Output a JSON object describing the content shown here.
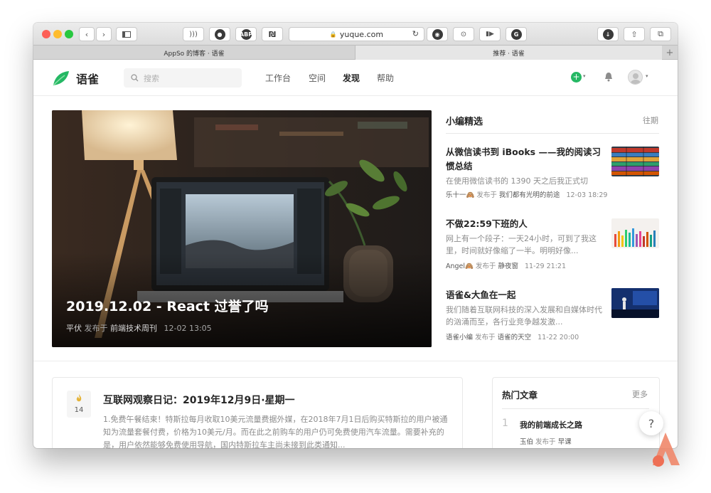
{
  "browser": {
    "url": "yuque.com",
    "tabs": [
      {
        "label": "AppSo 的博客 · 语雀",
        "active": false
      },
      {
        "label": "推荐 · 语雀",
        "active": true
      }
    ],
    "new_tab_symbol": "+"
  },
  "site": {
    "logo_text": "语雀",
    "search_placeholder": "搜索",
    "nav": [
      {
        "label": "工作台",
        "active": false
      },
      {
        "label": "空间",
        "active": false
      },
      {
        "label": "发现",
        "active": true
      },
      {
        "label": "帮助",
        "active": false
      }
    ],
    "accent_color": "#25b864"
  },
  "hero": {
    "title": "2019.12.02 - React 过誉了吗",
    "author": "平伏",
    "published_in_label": "发布于",
    "channel": "前端技术周刊",
    "time": "12-02 13:05"
  },
  "picks": {
    "heading": "小编精选",
    "more_label": "往期",
    "items": [
      {
        "title": "从微信读书到 iBooks ——我的阅读习惯总结",
        "desc": "在使用微信读书的 1390 天之后我正式切",
        "author": "乐十一🙈",
        "published_in_label": "发布于",
        "channel": "我们都有光明的前途",
        "time": "12-03 18:29"
      },
      {
        "title": "不做22:59下班的人",
        "desc": "网上有一个段子：一天24小时，可到了我这里，时间就好像缩了一半。明明好像...",
        "author": "Angel🙈",
        "published_in_label": "发布于",
        "channel": "静夜窗",
        "time": "11-29 21:21"
      },
      {
        "title": "语雀&大鱼在一起",
        "desc": "我们随着互联网科技的深入发展和自媒体时代的汹涌而至，各行业竞争越发激...",
        "author": "语雀小编",
        "published_in_label": "发布于",
        "channel": "语雀的天空",
        "time": "11-22 20:00"
      }
    ]
  },
  "article": {
    "day": "14",
    "title": "互联网观察日记：2019年12月9日·星期一",
    "body": "1.免费午餐结束！特斯拉每月收取10美元流量费据外媒，在2018年7月1日后购买特斯拉的用户被通知为流量套餐付费，价格为10美元/月。而在此之前购车的用户仍可免费使用汽车流量。需要补充的是，用户依然能够免费使用导航，国内特斯拉车主尚未接到此类通知..."
  },
  "hot": {
    "heading": "热门文章",
    "more_label": "更多",
    "items": [
      {
        "rank": "1",
        "title": "我的前端成长之路",
        "author": "玉伯",
        "published_in_label": "发布于",
        "channel": "早课"
      }
    ]
  },
  "help_label": "?"
}
